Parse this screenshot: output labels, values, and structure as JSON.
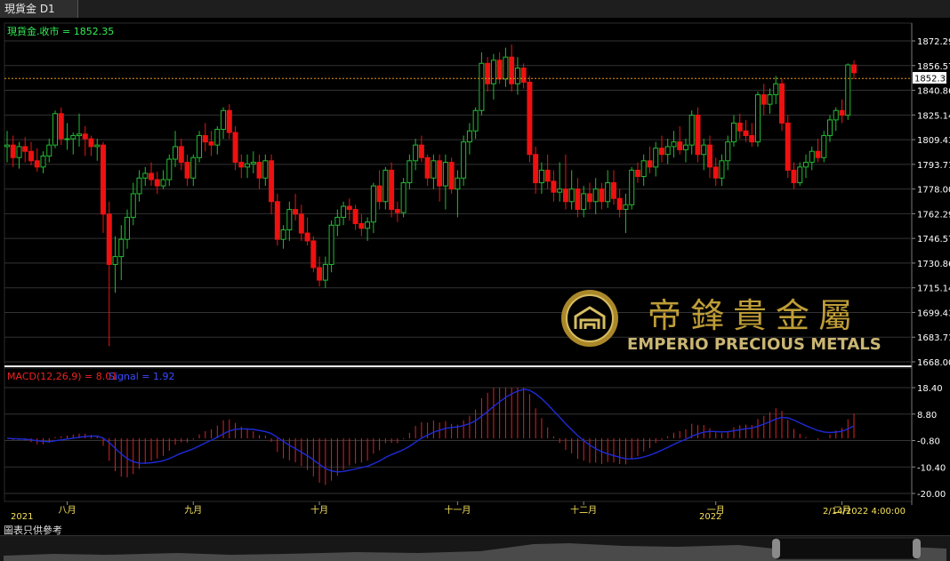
{
  "tab": {
    "title": "現貨金 D1"
  },
  "price_label": "現貨金.收市 = 1852.35",
  "macd_label": "MACD(12,26,9) = 8.01",
  "signal_label": "Signal = 1.92",
  "current_price_label": "1852.35",
  "watermark": {
    "name_cn": "帝鋒貴金屬",
    "name_en": "EMPERIO PRECIOUS METALS"
  },
  "footer_note": "圖表只供參考",
  "colors": {
    "up": "#22bb33",
    "down": "#ee1111",
    "macd_hist": "#dd2222",
    "signal": "#1d2bd6",
    "last_price_line": "#e69a1f",
    "axis_text": "#ffffff",
    "x_text": "#f5e15a",
    "gold": "#c9a63a"
  },
  "chart_data": [
    {
      "type": "candlestick",
      "title": "現貨金 D1",
      "series_label": "現貨金.收市 = 1852.35",
      "ylim": [
        1668.0,
        1872.29
      ],
      "yticks": [
        "1872.29",
        "1856.57",
        "1840.86",
        "1825.14",
        "1809.43",
        "1793.71",
        "1778.00",
        "1762.29",
        "1746.57",
        "1730.86",
        "1715.14",
        "1699.43",
        "1683.71",
        "1668.00"
      ],
      "last_price": 1852.35,
      "grid": true,
      "candles_note": "approximate daily OHLC (open, high, low, close) read off the chart, Jul 2021 – Feb 14 2022",
      "ohlc": [
        [
          1805,
          1815,
          1795,
          1806
        ],
        [
          1806,
          1812,
          1792,
          1798
        ],
        [
          1798,
          1808,
          1791,
          1805
        ],
        [
          1805,
          1811,
          1795,
          1802
        ],
        [
          1802,
          1808,
          1793,
          1796
        ],
        [
          1796,
          1804,
          1789,
          1792
        ],
        [
          1792,
          1802,
          1788,
          1799
        ],
        [
          1799,
          1810,
          1795,
          1806
        ],
        [
          1806,
          1828,
          1804,
          1826
        ],
        [
          1826,
          1830,
          1806,
          1810
        ],
        [
          1810,
          1820,
          1803,
          1810
        ],
        [
          1810,
          1814,
          1800,
          1812
        ],
        [
          1812,
          1826,
          1805,
          1813
        ],
        [
          1813,
          1818,
          1799,
          1810
        ],
        [
          1810,
          1812,
          1799,
          1805
        ],
        [
          1805,
          1810,
          1796,
          1806
        ],
        [
          1806,
          1808,
          1750,
          1762
        ],
        [
          1762,
          1770,
          1678,
          1730
        ],
        [
          1730,
          1748,
          1712,
          1735
        ],
        [
          1735,
          1755,
          1720,
          1746
        ],
        [
          1746,
          1765,
          1740,
          1760
        ],
        [
          1760,
          1782,
          1755,
          1775
        ],
        [
          1775,
          1790,
          1770,
          1785
        ],
        [
          1785,
          1792,
          1780,
          1788
        ],
        [
          1788,
          1795,
          1780,
          1784
        ],
        [
          1784,
          1789,
          1775,
          1780
        ],
        [
          1780,
          1790,
          1778,
          1784
        ],
        [
          1784,
          1800,
          1780,
          1797
        ],
        [
          1797,
          1815,
          1792,
          1805
        ],
        [
          1805,
          1810,
          1790,
          1795
        ],
        [
          1795,
          1800,
          1780,
          1785
        ],
        [
          1785,
          1800,
          1780,
          1798
        ],
        [
          1798,
          1815,
          1795,
          1812
        ],
        [
          1812,
          1820,
          1802,
          1808
        ],
        [
          1808,
          1815,
          1799,
          1806
        ],
        [
          1806,
          1818,
          1800,
          1816
        ],
        [
          1816,
          1830,
          1810,
          1828
        ],
        [
          1828,
          1832,
          1810,
          1814
        ],
        [
          1814,
          1818,
          1790,
          1795
        ],
        [
          1795,
          1800,
          1785,
          1792
        ],
        [
          1792,
          1800,
          1785,
          1794
        ],
        [
          1794,
          1802,
          1788,
          1795
        ],
        [
          1795,
          1800,
          1778,
          1785
        ],
        [
          1785,
          1800,
          1780,
          1796
        ],
        [
          1796,
          1800,
          1762,
          1770
        ],
        [
          1770,
          1775,
          1742,
          1746
        ],
        [
          1746,
          1755,
          1740,
          1752
        ],
        [
          1752,
          1770,
          1745,
          1765
        ],
        [
          1765,
          1775,
          1758,
          1762
        ],
        [
          1762,
          1768,
          1745,
          1750
        ],
        [
          1750,
          1760,
          1742,
          1745
        ],
        [
          1745,
          1748,
          1725,
          1728
        ],
        [
          1728,
          1735,
          1716,
          1720
        ],
        [
          1720,
          1735,
          1715,
          1730
        ],
        [
          1730,
          1758,
          1725,
          1755
        ],
        [
          1755,
          1765,
          1748,
          1760
        ],
        [
          1760,
          1770,
          1755,
          1767
        ],
        [
          1767,
          1772,
          1758,
          1765
        ],
        [
          1765,
          1768,
          1752,
          1756
        ],
        [
          1756,
          1762,
          1748,
          1753
        ],
        [
          1753,
          1760,
          1745,
          1757
        ],
        [
          1757,
          1782,
          1750,
          1780
        ],
        [
          1780,
          1790,
          1765,
          1770
        ],
        [
          1770,
          1792,
          1765,
          1790
        ],
        [
          1790,
          1795,
          1760,
          1765
        ],
        [
          1765,
          1770,
          1757,
          1763
        ],
        [
          1763,
          1785,
          1760,
          1782
        ],
        [
          1782,
          1800,
          1778,
          1796
        ],
        [
          1796,
          1810,
          1790,
          1806
        ],
        [
          1806,
          1812,
          1795,
          1798
        ],
        [
          1798,
          1800,
          1780,
          1785
        ],
        [
          1785,
          1800,
          1778,
          1796
        ],
        [
          1796,
          1800,
          1770,
          1780
        ],
        [
          1780,
          1800,
          1765,
          1795
        ],
        [
          1795,
          1798,
          1775,
          1778
        ],
        [
          1778,
          1790,
          1760,
          1785
        ],
        [
          1785,
          1812,
          1780,
          1808
        ],
        [
          1808,
          1820,
          1800,
          1815
        ],
        [
          1815,
          1830,
          1810,
          1828
        ],
        [
          1828,
          1865,
          1825,
          1858
        ],
        [
          1858,
          1862,
          1840,
          1845
        ],
        [
          1845,
          1864,
          1835,
          1860
        ],
        [
          1860,
          1865,
          1845,
          1848
        ],
        [
          1848,
          1868,
          1843,
          1862
        ],
        [
          1862,
          1870,
          1840,
          1845
        ],
        [
          1845,
          1862,
          1838,
          1855
        ],
        [
          1855,
          1858,
          1842,
          1846
        ],
        [
          1846,
          1850,
          1795,
          1800
        ],
        [
          1800,
          1805,
          1775,
          1782
        ],
        [
          1782,
          1795,
          1775,
          1790
        ],
        [
          1790,
          1800,
          1778,
          1783
        ],
        [
          1783,
          1790,
          1770,
          1776
        ],
        [
          1776,
          1795,
          1770,
          1778
        ],
        [
          1778,
          1800,
          1765,
          1770
        ],
        [
          1770,
          1790,
          1765,
          1778
        ],
        [
          1778,
          1785,
          1760,
          1765
        ],
        [
          1765,
          1780,
          1760,
          1775
        ],
        [
          1775,
          1782,
          1765,
          1770
        ],
        [
          1770,
          1785,
          1762,
          1778
        ],
        [
          1778,
          1782,
          1765,
          1770
        ],
        [
          1770,
          1790,
          1766,
          1782
        ],
        [
          1782,
          1790,
          1768,
          1772
        ],
        [
          1772,
          1778,
          1760,
          1765
        ],
        [
          1765,
          1775,
          1750,
          1768
        ],
        [
          1768,
          1792,
          1765,
          1790
        ],
        [
          1790,
          1795,
          1782,
          1786
        ],
        [
          1786,
          1800,
          1780,
          1796
        ],
        [
          1796,
          1805,
          1788,
          1792
        ],
        [
          1792,
          1808,
          1786,
          1804
        ],
        [
          1804,
          1812,
          1795,
          1800
        ],
        [
          1800,
          1810,
          1794,
          1805
        ],
        [
          1805,
          1815,
          1798,
          1808
        ],
        [
          1808,
          1818,
          1800,
          1803
        ],
        [
          1803,
          1810,
          1795,
          1806
        ],
        [
          1806,
          1828,
          1800,
          1825
        ],
        [
          1825,
          1830,
          1795,
          1800
        ],
        [
          1800,
          1810,
          1790,
          1806
        ],
        [
          1806,
          1812,
          1785,
          1792
        ],
        [
          1792,
          1798,
          1780,
          1785
        ],
        [
          1785,
          1800,
          1780,
          1796
        ],
        [
          1796,
          1812,
          1790,
          1808
        ],
        [
          1808,
          1825,
          1805,
          1820
        ],
        [
          1820,
          1826,
          1810,
          1815
        ],
        [
          1815,
          1822,
          1808,
          1812
        ],
        [
          1812,
          1820,
          1805,
          1808
        ],
        [
          1808,
          1840,
          1805,
          1838
        ],
        [
          1838,
          1845,
          1825,
          1832
        ],
        [
          1832,
          1842,
          1826,
          1838
        ],
        [
          1838,
          1850,
          1832,
          1845
        ],
        [
          1845,
          1848,
          1815,
          1820
        ],
        [
          1820,
          1825,
          1785,
          1790
        ],
        [
          1790,
          1795,
          1778,
          1782
        ],
        [
          1782,
          1795,
          1780,
          1792
        ],
        [
          1792,
          1800,
          1785,
          1795
        ],
        [
          1795,
          1805,
          1790,
          1802
        ],
        [
          1802,
          1810,
          1795,
          1798
        ],
        [
          1798,
          1815,
          1795,
          1812
        ],
        [
          1812,
          1825,
          1808,
          1822
        ],
        [
          1822,
          1830,
          1815,
          1828
        ],
        [
          1828,
          1835,
          1820,
          1825
        ],
        [
          1825,
          1858,
          1822,
          1857
        ],
        [
          1857,
          1860,
          1848,
          1852
        ]
      ]
    },
    {
      "type": "line",
      "title": "MACD(12,26,9)",
      "series": [
        {
          "name": "MACD(12,26,9) = 8.01",
          "style": "histogram",
          "color": "#dd2222"
        },
        {
          "name": "Signal = 1.92",
          "style": "line",
          "color": "#1d2bd6"
        }
      ],
      "ylim": [
        -20.0,
        18.4
      ],
      "yticks": [
        "18.40",
        "8.80",
        "-0.80",
        "-10.40",
        "-20.00"
      ],
      "last_macd": 8.01,
      "last_signal": 1.92
    }
  ],
  "x_axis": {
    "year_labels": [
      "2021",
      "2022"
    ],
    "month_labels": [
      "八月",
      "九月",
      "十月",
      "十一月",
      "十二月",
      "一月",
      "二月"
    ],
    "last_label": "2/14/2022 4:00:00"
  }
}
